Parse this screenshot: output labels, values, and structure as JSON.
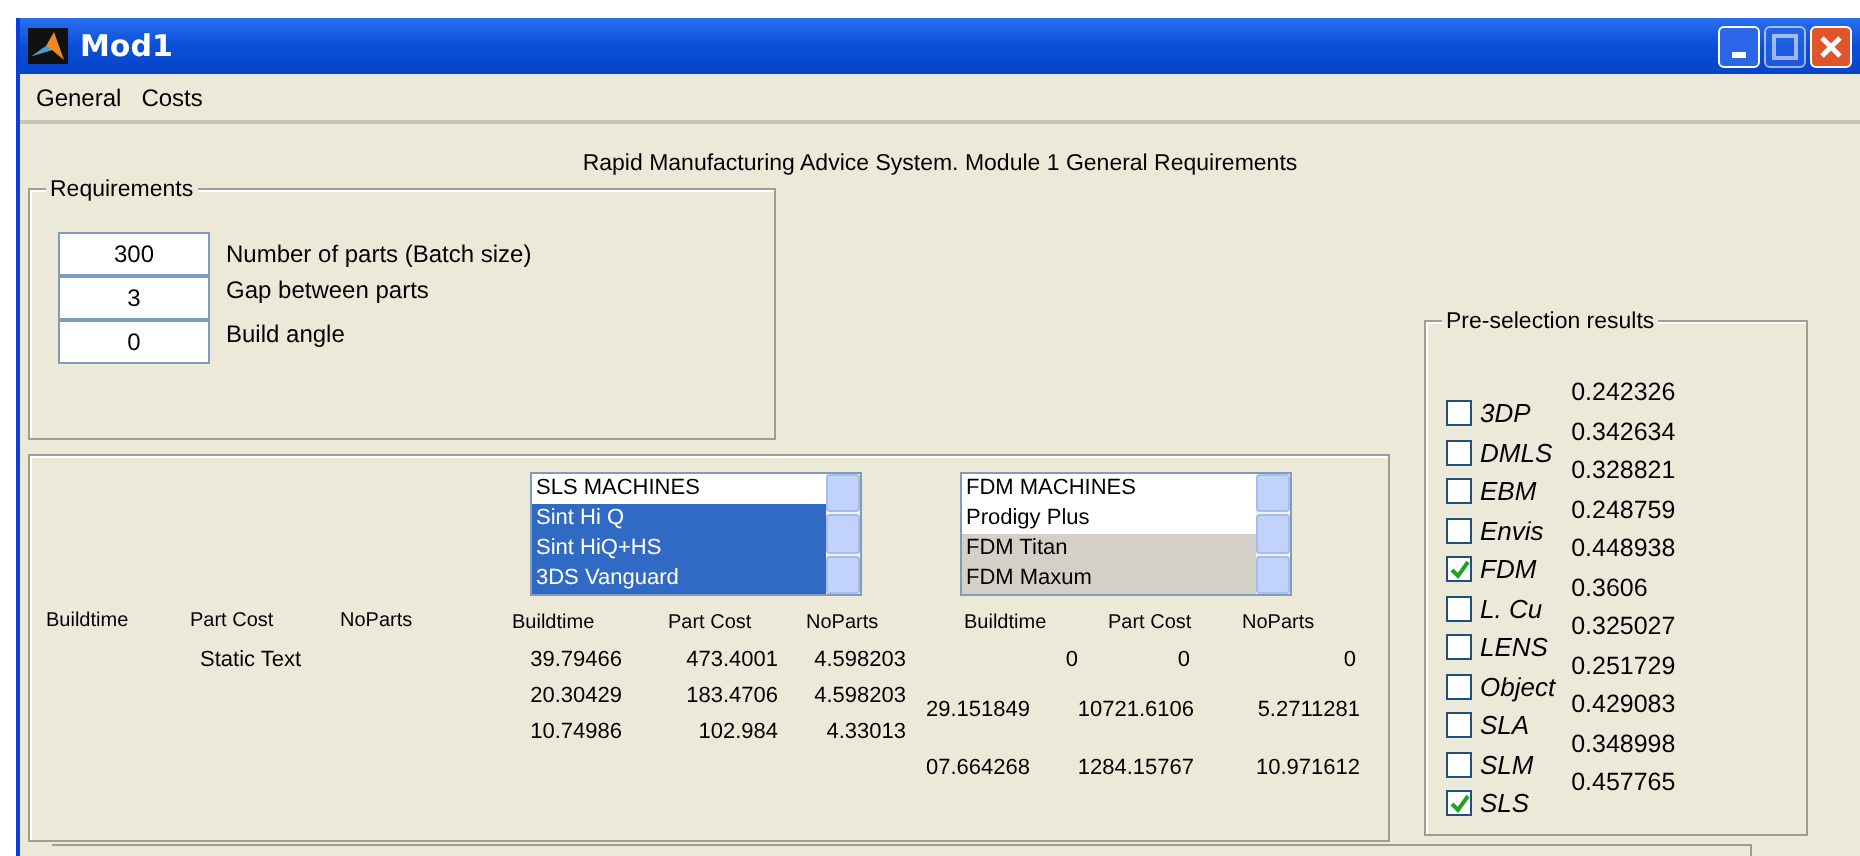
{
  "window": {
    "title": "Mod1"
  },
  "menu": [
    {
      "label": "General"
    },
    {
      "label": "Costs"
    }
  ],
  "heading": "Rapid Manufacturing Advice System. Module 1 General Requirements",
  "requirements": {
    "title": "Requirements",
    "fields": [
      {
        "value": "300",
        "label": "Number of parts (Batch size)"
      },
      {
        "value": "3",
        "label": "Gap between parts"
      },
      {
        "value": "0",
        "label": "Build angle"
      }
    ]
  },
  "results": {
    "left_columns": [
      "Buildtime",
      "Part Cost",
      "NoParts"
    ],
    "static_text": "Static Text",
    "listboxes": [
      {
        "items": [
          {
            "label": "SLS MACHINES",
            "selected": false
          },
          {
            "label": "Sint Hi Q",
            "selected": true
          },
          {
            "label": "Sint HiQ+HS",
            "selected": true
          },
          {
            "label": "3DS Vanguard",
            "selected": true
          }
        ]
      },
      {
        "items": [
          {
            "label": "FDM MACHINES",
            "selected": false
          },
          {
            "label": "Prodigy Plus",
            "selected": false
          },
          {
            "label": "FDM Titan",
            "selected": true
          },
          {
            "label": "FDM Maxum",
            "selected": true
          }
        ]
      }
    ],
    "tables": [
      {
        "columns": [
          "Buildtime",
          "Part Cost",
          "NoParts"
        ],
        "rows": [
          [
            "39.79466",
            "473.4001",
            "4.598203"
          ],
          [
            "20.30429",
            "183.4706",
            "4.598203"
          ],
          [
            "10.74986",
            "102.984",
            "4.33013"
          ]
        ]
      },
      {
        "columns": [
          "Buildtime",
          "Part Cost",
          "NoParts"
        ],
        "rows": [
          [
            "0",
            "0",
            "0"
          ],
          [
            "29.151849",
            "10721.6106",
            "5.2711281"
          ],
          [
            "07.664268",
            "1284.15767",
            "10.971612"
          ]
        ]
      }
    ]
  },
  "preselection": {
    "title": "Pre-selection results",
    "items": [
      {
        "label": "3DP",
        "checked": false
      },
      {
        "label": "DMLS",
        "checked": false
      },
      {
        "label": "EBM",
        "checked": false
      },
      {
        "label": "Envis",
        "checked": false
      },
      {
        "label": "FDM",
        "checked": true
      },
      {
        "label": "L. Cu",
        "checked": false
      },
      {
        "label": "LENS",
        "checked": false
      },
      {
        "label": "Object",
        "checked": false
      },
      {
        "label": "SLA",
        "checked": false
      },
      {
        "label": "SLM",
        "checked": false
      },
      {
        "label": "SLS",
        "checked": true
      }
    ],
    "scores": [
      "0.242326",
      "0.342634",
      "0.328821",
      "0.248759",
      "0.448938",
      "0.3606",
      "0.325027",
      "0.251729",
      "0.429083",
      "0.348998",
      "0.457765"
    ]
  }
}
